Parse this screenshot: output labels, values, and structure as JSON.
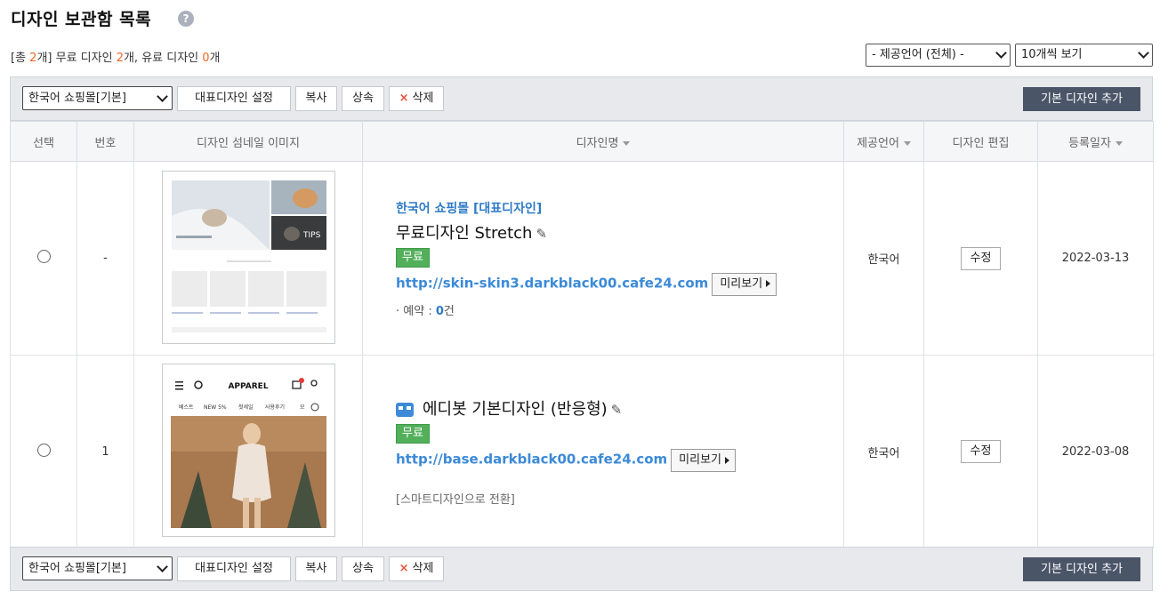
{
  "page": {
    "title": "디자인 보관함 목록",
    "help": "?"
  },
  "summary": {
    "prefix": "[총 ",
    "total": "2",
    "mid1": "개] 무료 디자인 ",
    "free": "2",
    "mid2": "개, 유료 디자인 ",
    "paid": "0",
    "suffix": "개"
  },
  "filters": {
    "language": "- 제공언어 (전체) -",
    "per_page": "10개씩 보기"
  },
  "toolbar": {
    "mall_select": "한국어 쇼핑몰[기본]",
    "set_default": "대표디자인 설정",
    "copy": "복사",
    "inherit": "상속",
    "delete": "삭제",
    "delete_icon": "×",
    "add_design": "기본 디자인 추가"
  },
  "table": {
    "headers": [
      "선택",
      "번호",
      "디자인 섬네일 이미지",
      "디자인명",
      "제공언어",
      "디자인 편집",
      "등록일자"
    ],
    "rows": [
      {
        "number": "-",
        "shop_label": "한국어 쇼핑몰 [대표디자인]",
        "name": "무료디자인 Stretch",
        "badge": "무료",
        "url": "http://skin-skin3.darkblack00.cafe24.com",
        "preview": "미리보기",
        "reservation_label": "예약 : ",
        "reservation_count": "0",
        "reservation_unit": "건",
        "language": "한국어",
        "edit": "수정",
        "date": "2022-03-13",
        "thumb_text": "TIPS"
      },
      {
        "number": "1",
        "name": "에디봇 기본디자인 (반응형)",
        "badge": "무료",
        "url": "http://base.darkblack00.cafe24.com",
        "preview": "미리보기",
        "smart_convert": "[스마트디자인으로 전환]",
        "language": "한국어",
        "edit": "수정",
        "date": "2022-03-08",
        "thumb_brand": "APPAREL",
        "thumb_nav": [
          "베스트",
          "NEW 5%",
          "첫세일",
          "사용후기",
          "모"
        ]
      }
    ]
  },
  "colors": {
    "accent_orange": "#f26522",
    "link_blue": "#3c8ad8",
    "badge_green": "#52b05b",
    "dark_button": "#4a5568"
  }
}
